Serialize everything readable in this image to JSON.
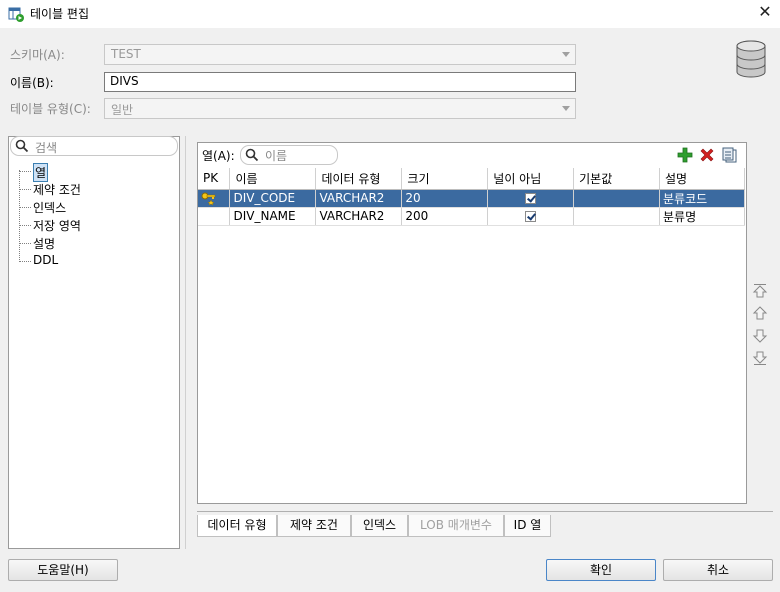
{
  "window": {
    "title": "테이블 편집",
    "close_label": "✕"
  },
  "form": {
    "schema_label": "스키마(A):",
    "schema_value": "TEST",
    "name_label": "이름(B):",
    "name_value": "DIVS",
    "type_label": "테이블 유형(C):",
    "type_value": "일반"
  },
  "nav": {
    "search_placeholder": "검색",
    "items": [
      "열",
      "제약 조건",
      "인덱스",
      "저장 영역",
      "설명",
      "DDL"
    ]
  },
  "columns_panel": {
    "label": "열(A):",
    "search_placeholder": "이름",
    "headers": [
      "PK",
      "이름",
      "데이터 유형",
      "크기",
      "널이 아님",
      "기본값",
      "설명"
    ],
    "rows": [
      {
        "pk": true,
        "name": "DIV_CODE",
        "type": "VARCHAR2",
        "size": "20",
        "not_null": true,
        "default": "",
        "comment": "분류코드"
      },
      {
        "pk": false,
        "name": "DIV_NAME",
        "type": "VARCHAR2",
        "size": "200",
        "not_null": true,
        "default": "",
        "comment": "분류명"
      }
    ]
  },
  "tabs": [
    "데이터 유형",
    "제약 조건",
    "인덱스",
    "LOB 매개변수",
    "ID 열"
  ],
  "buttons": {
    "help": "도움말(H)",
    "ok": "확인",
    "cancel": "취소"
  },
  "colors": {
    "selected_row": "#3b6aa0",
    "add_icon": "#2e9e2e",
    "delete_icon": "#d42020"
  }
}
